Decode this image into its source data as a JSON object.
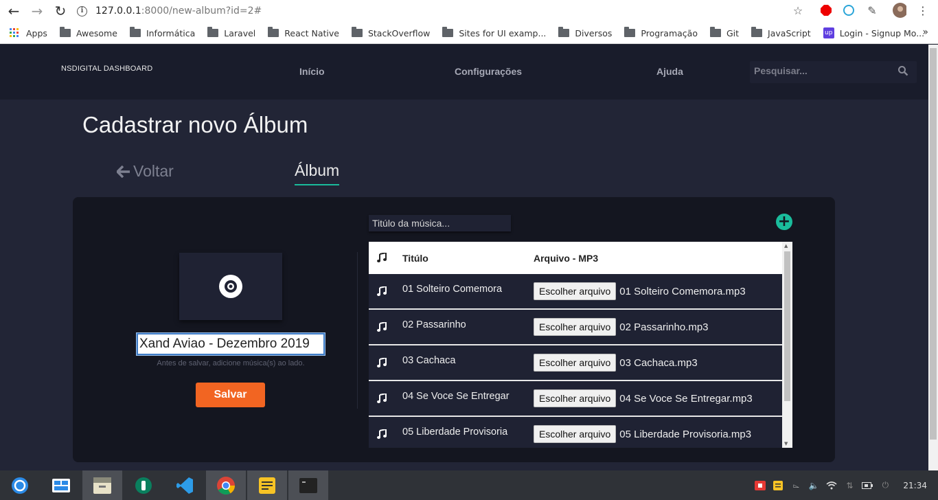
{
  "browser": {
    "url_host": "127.0.0.1",
    "url_path": ":8000/new-album?id=2#",
    "bookmarks": [
      "Apps",
      "Awesome",
      "Informática",
      "Laravel",
      "React Native",
      "StackOverflow",
      "Sites for UI examp...",
      "Diversos",
      "Programação",
      "Git",
      "JavaScript",
      "Login - Signup Mo..."
    ]
  },
  "nav": {
    "brand": "NSDIGITAL DASHBOARD",
    "items": [
      "Início",
      "Configurações",
      "Ajuda"
    ],
    "search_placeholder": "Pesquisar..."
  },
  "page": {
    "title": "Cadastrar novo Álbum",
    "back_label": "Voltar",
    "tab_label": "Álbum"
  },
  "album": {
    "name": "Xand Aviao - Dezembro 2019",
    "hint": "Antes de salvar, adicione música(s) ao lado.",
    "save_label": "Salvar"
  },
  "songs": {
    "title_placeholder": "Titúlo da música...",
    "col_title": "Titúlo",
    "col_file": "Arquivo - MP3",
    "choose_label": "Escolher arquivo",
    "rows": [
      {
        "title": "01 Solteiro Comemora",
        "file": "01 Solteiro Comemora.mp3"
      },
      {
        "title": "02 Passarinho",
        "file": "02 Passarinho.mp3"
      },
      {
        "title": "03 Cachaca",
        "file": "03 Cachaca.mp3"
      },
      {
        "title": "04 Se Voce Se Entregar",
        "file": "04 Se Voce Se Entregar.mp3"
      },
      {
        "title": "05 Liberdade Provisoria",
        "file": "05 Liberdade Provisoria.mp3"
      }
    ]
  },
  "taskbar": {
    "clock": "21:34"
  },
  "colors": {
    "accent": "#1abc9c",
    "save": "#f26522",
    "bg": "#222536",
    "navbar": "#191c2b"
  }
}
